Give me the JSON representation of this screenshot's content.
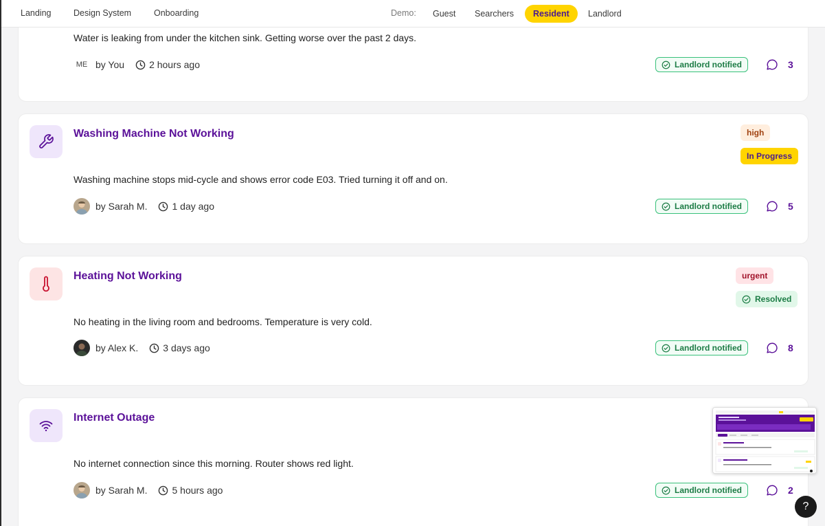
{
  "nav": {
    "links": [
      "Landing",
      "Design System",
      "Onboarding"
    ],
    "demo_label": "Demo:",
    "demo_options": [
      "Guest",
      "Searchers",
      "Resident",
      "Landlord"
    ],
    "demo_selected": "Resident"
  },
  "issues": [
    {
      "title": "",
      "description": "Water is leaking from under the kitchen sink. Getting worse over the past 2 days.",
      "author_avatar": "ME",
      "author": "by You",
      "time": "2 hours ago",
      "notified": "Landlord notified",
      "comments": "3"
    },
    {
      "icon": "wrench-icon",
      "title": "Washing Machine Not Working",
      "priority": "high",
      "status": "In Progress",
      "description": "Washing machine stops mid-cycle and shows error code E03. Tried turning it off and on.",
      "author": "by Sarah M.",
      "time": "1 day ago",
      "notified": "Landlord notified",
      "comments": "5"
    },
    {
      "icon": "thermometer-icon",
      "title": "Heating Not Working",
      "priority": "urgent",
      "status": "Resolved",
      "description": "No heating in the living room and bedrooms. Temperature is very cold.",
      "author": "by Alex K.",
      "time": "3 days ago",
      "notified": "Landlord notified",
      "comments": "8"
    },
    {
      "icon": "wifi-icon",
      "title": "Internet Outage",
      "description": "No internet connection since this morning. Router shows red light.",
      "author": "by Sarah M.",
      "time": "5 hours ago",
      "notified": "Landlord notified",
      "comments": "2"
    }
  ],
  "help_label": "?",
  "colors": {
    "accent": "#5b1199",
    "highlight": "#ffd400",
    "success": "#1c7c45"
  }
}
